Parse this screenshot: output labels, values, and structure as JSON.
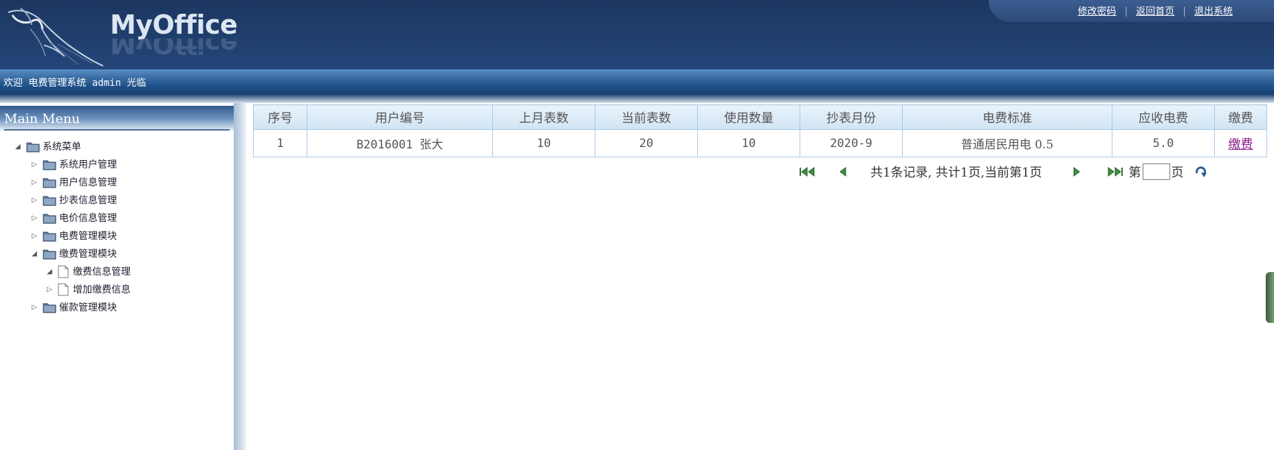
{
  "header": {
    "logo_text": "MyOffice",
    "links": [
      "修改密码",
      "返回首页",
      "退出系统"
    ]
  },
  "welcome": "欢迎 电费管理系统 admin 光临",
  "sidebar": {
    "title": "Main Menu",
    "root": "系统菜单",
    "items": [
      {
        "label": "系统用户管理",
        "expanded": false
      },
      {
        "label": "用户信息管理",
        "expanded": false
      },
      {
        "label": "抄表信息管理",
        "expanded": false
      },
      {
        "label": "电价信息管理",
        "expanded": false
      },
      {
        "label": "电费管理模块",
        "expanded": false
      },
      {
        "label": "缴费管理模块",
        "expanded": true
      },
      {
        "label": "缴费信息管理",
        "expanded": true
      },
      {
        "label": "增加缴费信息",
        "expanded": false
      },
      {
        "label": "催款管理模块",
        "expanded": false
      }
    ]
  },
  "table": {
    "headers": [
      "序号",
      "用户编号",
      "上月表数",
      "当前表数",
      "使用数量",
      "抄表月份",
      "电费标准",
      "应收电费",
      "缴费"
    ],
    "rows": [
      [
        "1",
        "B2016001 张大",
        "10",
        "20",
        "10",
        "2020-9",
        "普通居民用电 0.5",
        "5.0",
        "缴费"
      ]
    ]
  },
  "pager": {
    "summary": "共1条记录, 共计1页,当前第1页",
    "page_prefix": "第",
    "page_suffix": "页",
    "page_input": ""
  },
  "colors": {
    "header_bg": "#21406f",
    "link_visited": "#8a1d8a",
    "table_border": "#a9c7e3"
  }
}
